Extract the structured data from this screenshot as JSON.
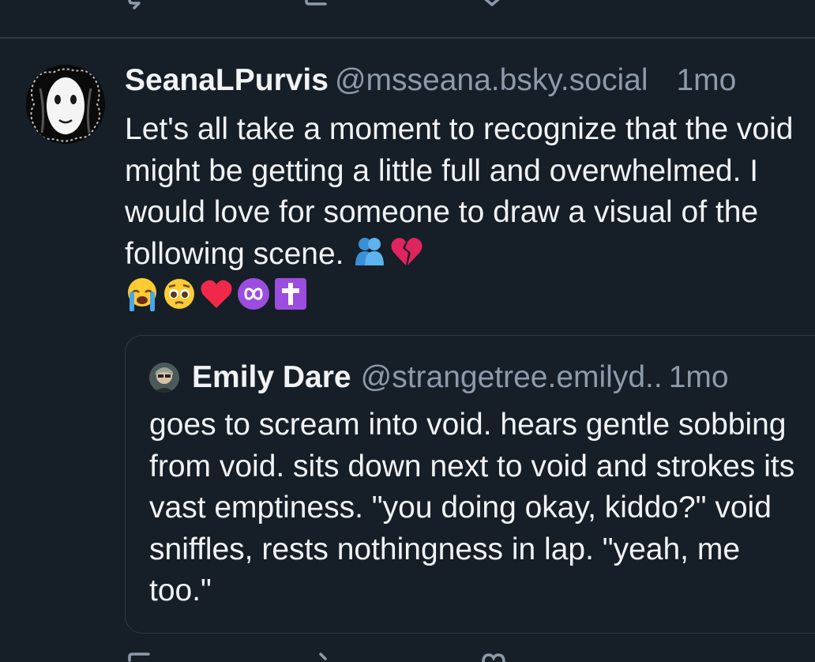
{
  "post": {
    "author": {
      "display_name": "SeanaLPurvis",
      "handle": "@msseana.bsky.social",
      "avatar": "avatar"
    },
    "time": "1mo",
    "text": "Let's all take a moment to recognize that the void might be getting a little full and overwhelmed. I would love for someone to draw a visual of the following scene.",
    "emojis": [
      "hugging-people-emoji",
      "broken-heart-emoji",
      "loudly-crying-face-emoji",
      "pleading-face-emoji",
      "red-heart-emoji",
      "infinity-emoji",
      "latin-cross-emoji"
    ],
    "quote": {
      "author": {
        "display_name": "Emily Dare",
        "handle": "@strangetree.emilyd..",
        "avatar": "avatar"
      },
      "time": "1mo",
      "text": "goes to scream into void. hears gentle sobbing from void. sits down next to void and strokes its vast emptiness. \"you doing okay, kiddo?\" void sniffles, rests nothingness in lap. \"yeah, me too.\""
    }
  },
  "actions": [
    "reply-icon",
    "repost-icon",
    "like-icon"
  ],
  "colors": {
    "background": "#161e27",
    "text": "#f1f3f5",
    "muted": "#8d9aaa",
    "border": "#2e3a47"
  }
}
